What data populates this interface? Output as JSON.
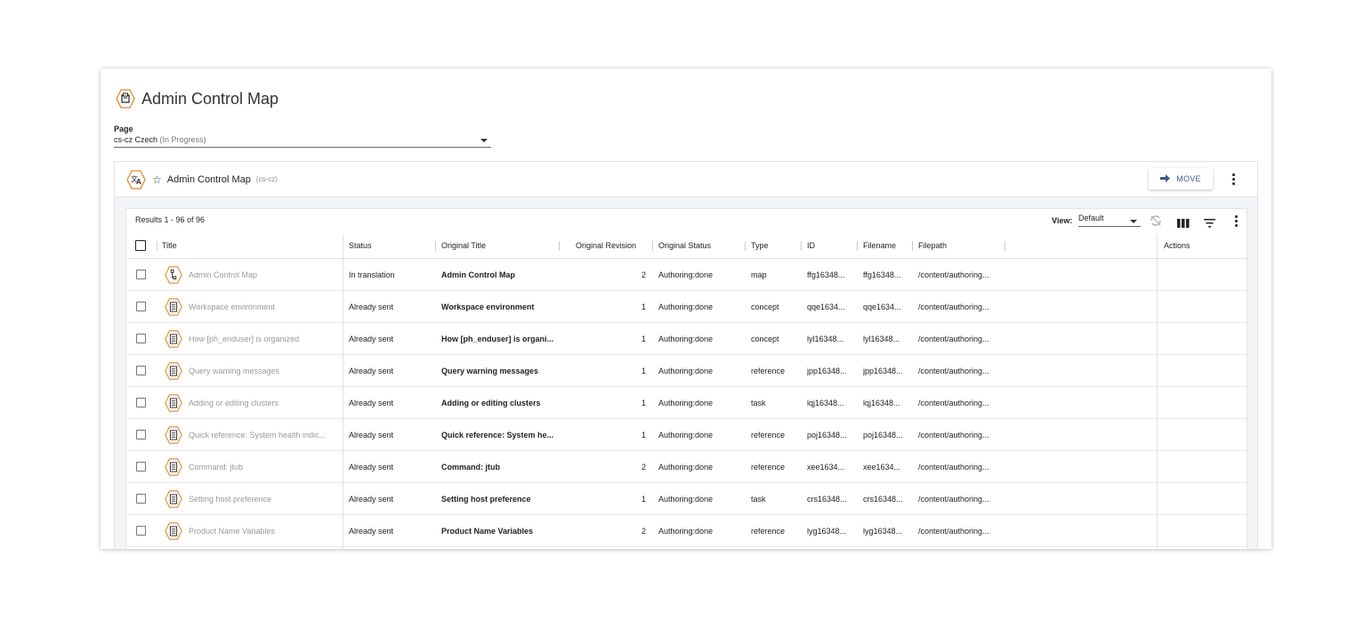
{
  "header": {
    "title": "Admin Control Map",
    "icon": "map-hex-icon"
  },
  "page_select": {
    "label": "Page",
    "value": "cs-cz Czech",
    "status": "(In Progress)"
  },
  "panel": {
    "title": "Admin Control Map",
    "locale": "(cs-cz)",
    "move_label": "MOVE",
    "icon": "translate-hex-icon"
  },
  "table": {
    "results": "Results 1 - 96 of 96",
    "view_label": "View:",
    "view_value": "Default",
    "columns": [
      "Title",
      "Status",
      "Original Title",
      "Original Revision",
      "Original Status",
      "Type",
      "ID",
      "Filename",
      "Filepath",
      "Actions"
    ],
    "rows": [
      {
        "title": "Admin Control Map",
        "status": "In translation",
        "original_title": "Admin Control Map",
        "revision": "2",
        "original_status": "Authoring:done",
        "type": "map",
        "id": "ffg16348...",
        "filename": "ffg16348...",
        "filepath": "/content/authoring...",
        "icon": "map"
      },
      {
        "title": "Workspace environment",
        "status": "Already sent",
        "original_title": "Workspace environment",
        "revision": "1",
        "original_status": "Authoring:done",
        "type": "concept",
        "id": "qqe1634...",
        "filename": "qqe1634...",
        "filepath": "/content/authoring...",
        "icon": "doc"
      },
      {
        "title": "How [ph_enduser] is organized",
        "status": "Already sent",
        "original_title": "How [ph_enduser] is organi...",
        "revision": "1",
        "original_status": "Authoring:done",
        "type": "concept",
        "id": "lyl16348...",
        "filename": "lyl16348...",
        "filepath": "/content/authoring...",
        "icon": "doc"
      },
      {
        "title": "Query warning messages",
        "status": "Already sent",
        "original_title": "Query warning messages",
        "revision": "1",
        "original_status": "Authoring:done",
        "type": "reference",
        "id": "jpp16348...",
        "filename": "jpp16348...",
        "filepath": "/content/authoring...",
        "icon": "doc"
      },
      {
        "title": "Adding or editing clusters",
        "status": "Already sent",
        "original_title": "Adding or editing clusters",
        "revision": "1",
        "original_status": "Authoring:done",
        "type": "task",
        "id": "lqj16348...",
        "filename": "lqj16348...",
        "filepath": "/content/authoring...",
        "icon": "doc"
      },
      {
        "title": "Quick reference: System health indic...",
        "status": "Already sent",
        "original_title": "Quick reference: System he...",
        "revision": "1",
        "original_status": "Authoring:done",
        "type": "reference",
        "id": "poj16348...",
        "filename": "poj16348...",
        "filepath": "/content/authoring...",
        "icon": "doc"
      },
      {
        "title": "Command: jtub",
        "status": "Already sent",
        "original_title": "Command: jtub",
        "revision": "2",
        "original_status": "Authoring:done",
        "type": "reference",
        "id": "xee1634...",
        "filename": "xee1634...",
        "filepath": "/content/authoring...",
        "icon": "doc"
      },
      {
        "title": "Setting host preference",
        "status": "Already sent",
        "original_title": "Setting host preference",
        "revision": "1",
        "original_status": "Authoring:done",
        "type": "task",
        "id": "crs16348...",
        "filename": "crs16348...",
        "filepath": "/content/authoring...",
        "icon": "doc"
      },
      {
        "title": "Product Name Variables",
        "status": "Already sent",
        "original_title": "Product Name Variables",
        "revision": "2",
        "original_status": "Authoring:done",
        "type": "reference",
        "id": "lyg16348...",
        "filename": "lyg16348...",
        "filepath": "/content/authoring...",
        "icon": "doc"
      }
    ]
  },
  "colors": {
    "accent": "#e8892b",
    "move_text": "#3b5c80",
    "muted_title": "#999999"
  }
}
